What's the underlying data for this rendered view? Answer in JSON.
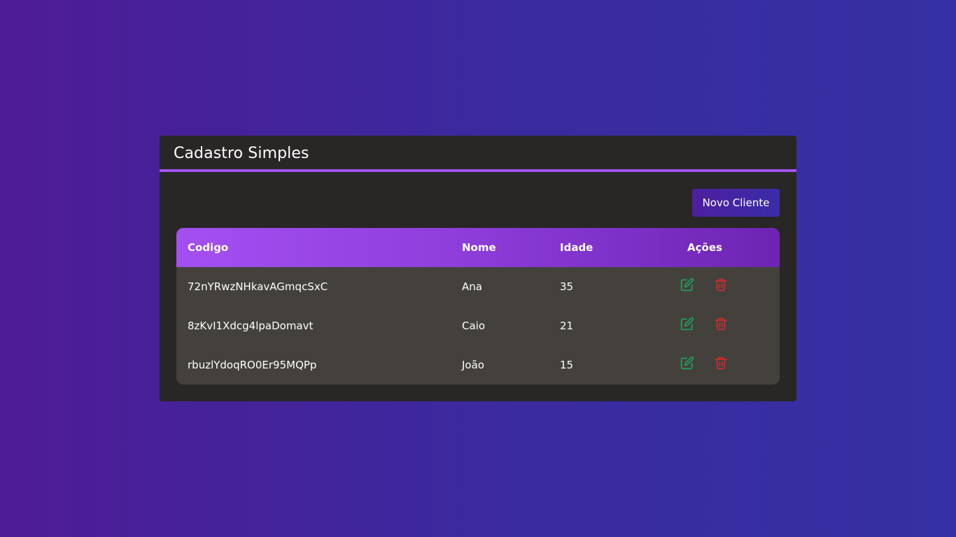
{
  "app": {
    "title": "Cadastro Simples"
  },
  "toolbar": {
    "new_client_label": "Novo Cliente"
  },
  "table": {
    "headers": {
      "code": "Codigo",
      "name": "Nome",
      "age": "Idade",
      "actions": "Ações"
    },
    "rows": [
      {
        "code": "72nYRwzNHkavAGmqcSxC",
        "name": "Ana",
        "age": "35"
      },
      {
        "code": "8zKvI1Xdcg4lpaDomavt",
        "name": "Caio",
        "age": "21"
      },
      {
        "code": "rbuzlYdoqRO0Er95MQPp",
        "name": "João",
        "age": "15"
      }
    ],
    "row_actions": [
      {
        "icon": "edit-icon",
        "color": "#1fa35a"
      },
      {
        "icon": "trash-icon",
        "color": "#d42a2a"
      }
    ]
  },
  "colors": {
    "accent": "#a355f0",
    "card_bg": "#292626",
    "table_body_bg": "#44413d",
    "edit": "#1fa35a",
    "delete": "#d42a2a"
  }
}
